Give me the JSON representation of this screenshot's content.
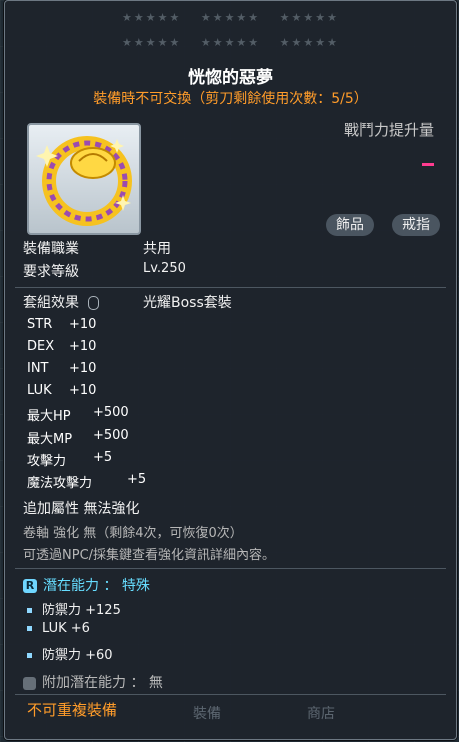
{
  "stars": {
    "row1": [
      "★★★★★",
      "★★★★★",
      "★★★★★"
    ],
    "row2": [
      "★★★★★",
      "★★★★★",
      "★★★★★"
    ]
  },
  "item": {
    "name": "恍惚的惡夢",
    "trade_note": "裝備時不可交換（剪刀剩餘使用次數：5/5）",
    "power_label": "戰鬥力提升量",
    "tags": [
      "飾品",
      "戒指"
    ]
  },
  "info": {
    "job_label": "裝備職業",
    "job_value": "共用",
    "level_label": "要求等級",
    "level_value": "Lv.250",
    "set_label": "套組效果",
    "set_value": "光耀Boss套裝"
  },
  "stats": [
    {
      "name": "STR",
      "value": "+10"
    },
    {
      "name": "DEX",
      "value": "+10"
    },
    {
      "name": "INT",
      "value": "+10"
    },
    {
      "name": "LUK",
      "value": "+10"
    },
    {
      "name": "最大HP",
      "value": "+500"
    },
    {
      "name": "最大MP",
      "value": "+500"
    },
    {
      "name": "攻擊力",
      "value": "+5"
    },
    {
      "name": "魔法攻擊力",
      "value": "+5"
    }
  ],
  "extra": {
    "flame": "追加屬性  無法強化",
    "scroll": "卷軸 強化 無（剩餘4次，可恢復0次）",
    "hint": "可透過NPC/採集鍵查看強化資訊詳細內容。"
  },
  "potential": {
    "grade_badge": "R",
    "title": "潛在能力 ： 特殊",
    "lines": [
      "防禦力 +125",
      "LUK +6",
      "防禦力 +60"
    ]
  },
  "bonus_potential": "附加潛在能力 ： 無",
  "footer": {
    "note": "不可重複裝備",
    "btn_equip": "裝備",
    "btn_shop": "商店"
  },
  "colors": {
    "orange": "#ff9c2a",
    "cyan": "#66ddff",
    "pink": "#ff3c8f"
  }
}
